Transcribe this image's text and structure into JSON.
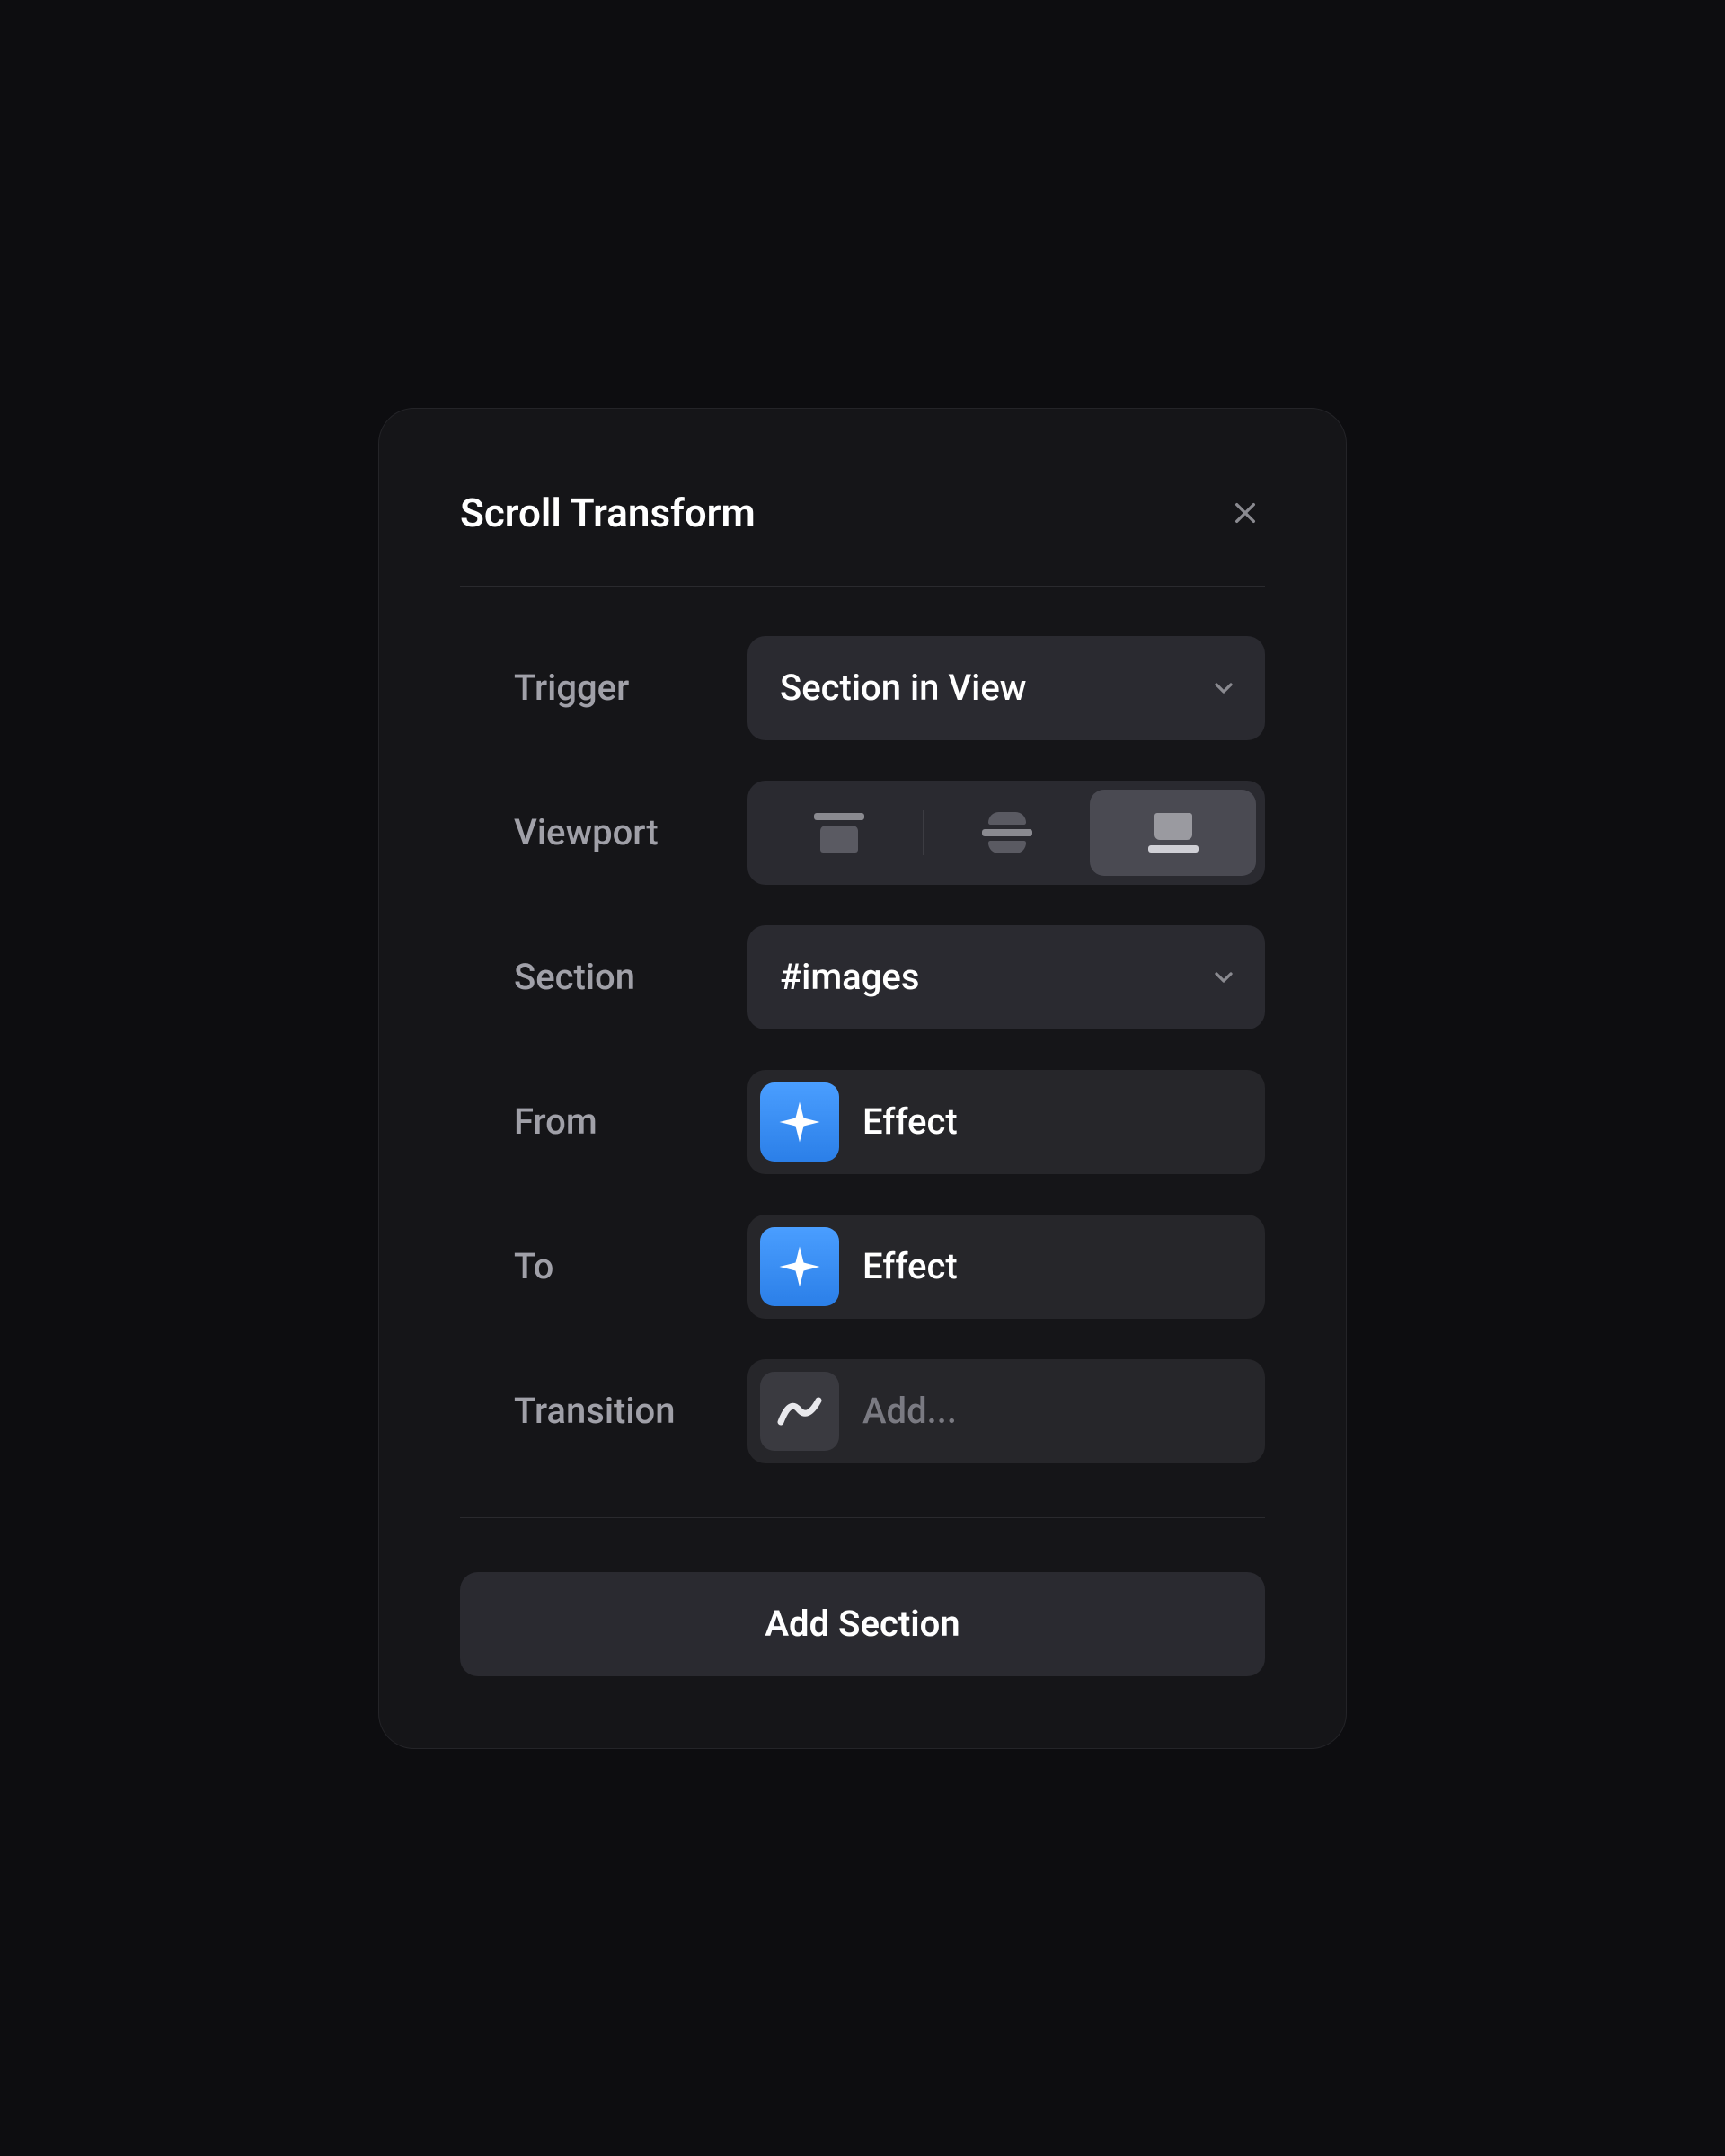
{
  "panel": {
    "title": "Scroll Transform"
  },
  "fields": {
    "trigger": {
      "label": "Trigger",
      "value": "Section in View"
    },
    "viewport": {
      "label": "Viewport"
    },
    "section": {
      "label": "Section",
      "value": "#images"
    },
    "from": {
      "label": "From",
      "value": "Effect"
    },
    "to": {
      "label": "To",
      "value": "Effect"
    },
    "transition": {
      "label": "Transition",
      "placeholder": "Add..."
    }
  },
  "button": {
    "add_section": "Add Section"
  }
}
